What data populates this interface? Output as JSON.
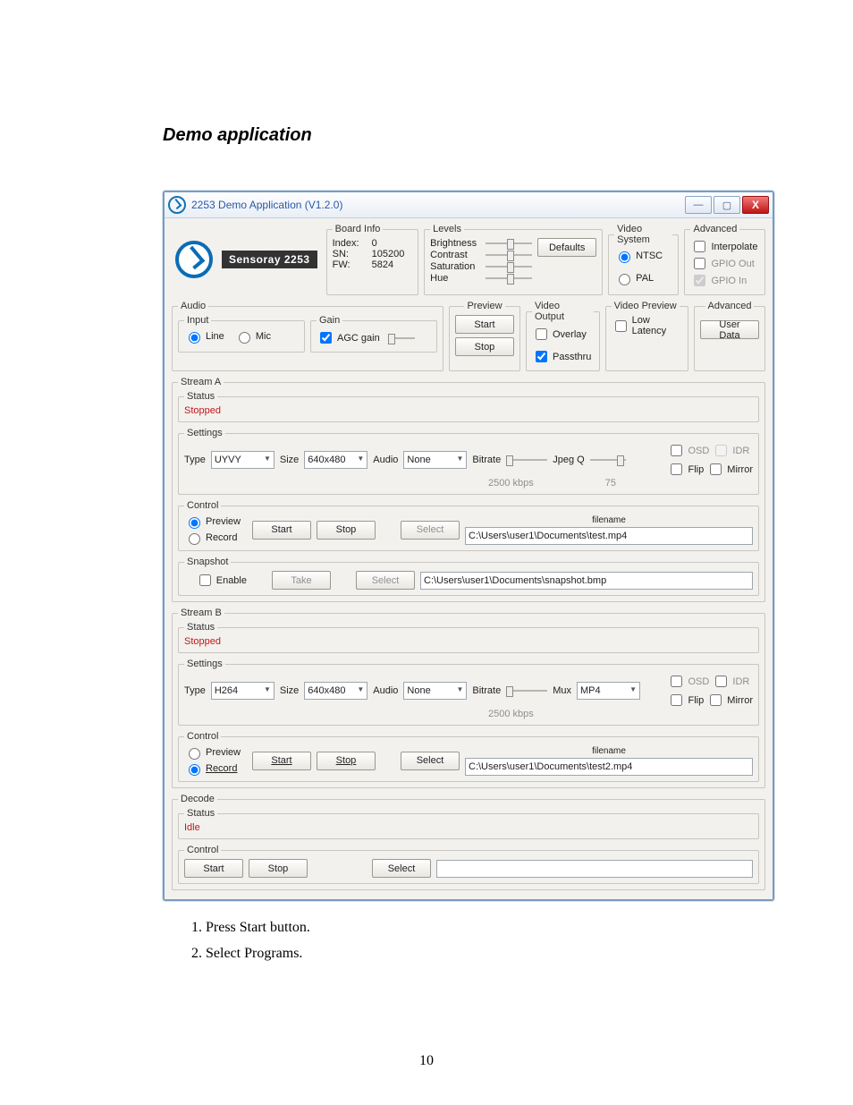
{
  "doc": {
    "heading": "Demo application",
    "instructions": [
      "Press Start button.",
      "Select Programs."
    ],
    "page_number": "10"
  },
  "window": {
    "title": "2253 Demo Application (V1.2.0)",
    "logo_text": "Sensoray 2253",
    "board_info": {
      "legend": "Board Info",
      "index_k": "Index:",
      "index_v": "0",
      "sn_k": "SN:",
      "sn_v": "105200",
      "fw_k": "FW:",
      "fw_v": "5824"
    },
    "levels": {
      "legend": "Levels",
      "brightness": "Brightness",
      "contrast": "Contrast",
      "saturation": "Saturation",
      "hue": "Hue",
      "defaults": "Defaults"
    },
    "vsystem": {
      "legend": "Video System",
      "ntsc": "NTSC",
      "pal": "PAL"
    },
    "advanced_top": {
      "legend": "Advanced",
      "interp": "Interpolate",
      "gpio_out": "GPIO Out",
      "gpio_in": "GPIO In"
    },
    "audio": {
      "legend": "Audio",
      "input_legend": "Input",
      "line": "Line",
      "mic": "Mic",
      "gain_legend": "Gain",
      "agc": "AGC gain"
    },
    "preview": {
      "legend": "Preview",
      "start": "Start",
      "stop": "Stop"
    },
    "video_output": {
      "legend": "Video Output",
      "overlay": "Overlay",
      "passthru": "Passthru"
    },
    "video_preview": {
      "legend": "Video Preview",
      "low_latency": "Low Latency"
    },
    "advanced_right": {
      "legend": "Advanced",
      "user_data": "User Data"
    },
    "streamA": {
      "legend": "Stream A",
      "status_legend": "Status",
      "status_text": "Stopped",
      "settings_legend": "Settings",
      "type_label": "Type",
      "type_value": "UYVY",
      "size_label": "Size",
      "size_value": "640x480",
      "audio_label": "Audio",
      "audio_value": "None",
      "bitrate_label": "Bitrate",
      "bitrate_value": "2500 kbps",
      "jpegq_label": "Jpeg Q",
      "jpegq_value": "75",
      "osd": "OSD",
      "idr": "IDR",
      "flip": "Flip",
      "mirror": "Mirror",
      "control_legend": "Control",
      "preview": "Preview",
      "record": "Record",
      "start": "Start",
      "stop": "Stop",
      "select": "Select",
      "filename_label": "filename",
      "filename_value": "C:\\Users\\user1\\Documents\\test.mp4",
      "snapshot_legend": "Snapshot",
      "enable": "Enable",
      "take": "Take",
      "snap_filename": "C:\\Users\\user1\\Documents\\snapshot.bmp"
    },
    "streamB": {
      "legend": "Stream B",
      "status_legend": "Status",
      "status_text": "Stopped",
      "settings_legend": "Settings",
      "type_label": "Type",
      "type_value": "H264",
      "size_label": "Size",
      "size_value": "640x480",
      "audio_label": "Audio",
      "audio_value": "None",
      "bitrate_label": "Bitrate",
      "bitrate_value": "2500 kbps",
      "mux_label": "Mux",
      "mux_value": "MP4",
      "osd": "OSD",
      "idr": "IDR",
      "flip": "Flip",
      "mirror": "Mirror",
      "control_legend": "Control",
      "preview": "Preview",
      "record": "Record",
      "start": "Start",
      "stop": "Stop",
      "select": "Select",
      "filename_label": "filename",
      "filename_value": "C:\\Users\\user1\\Documents\\test2.mp4"
    },
    "decode": {
      "legend": "Decode",
      "status_legend": "Status",
      "status_text": "Idle",
      "control_legend": "Control",
      "start": "Start",
      "stop": "Stop",
      "select": "Select"
    }
  }
}
